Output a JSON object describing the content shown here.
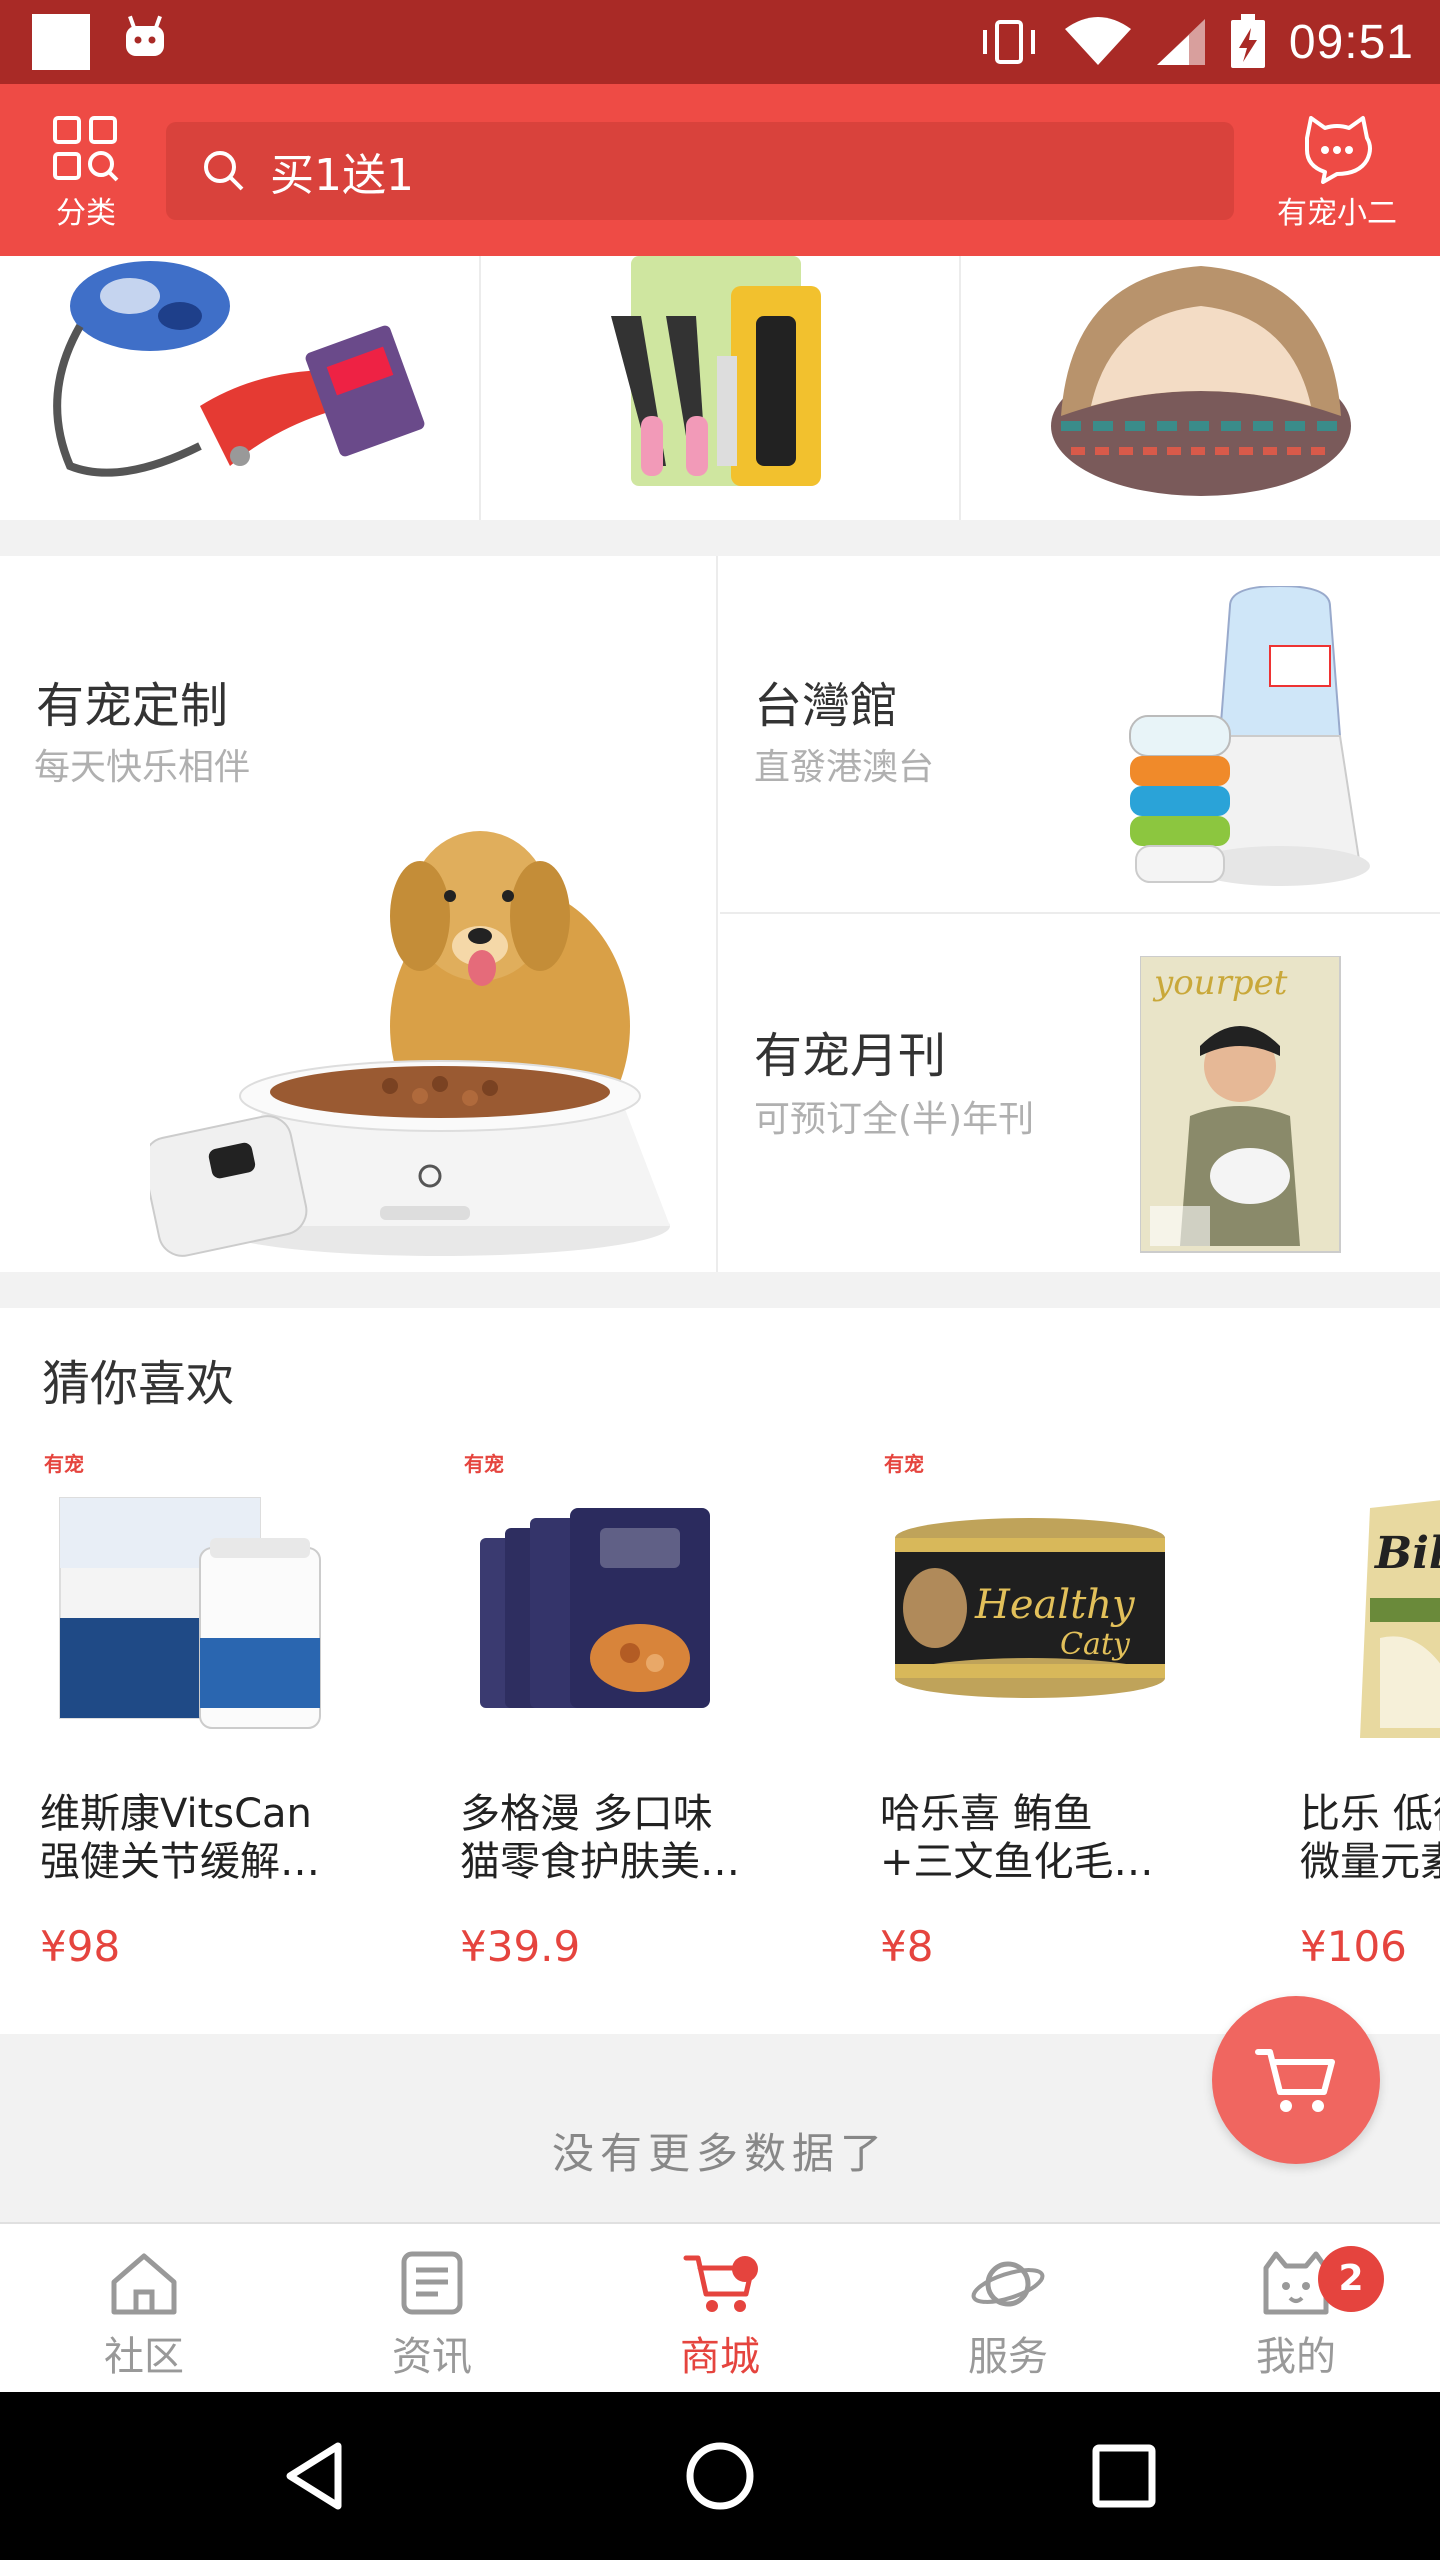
{
  "status_bar": {
    "time": "09:51"
  },
  "header": {
    "category_label": "分类",
    "search_text": "买1送1",
    "service_label": "有宠小二"
  },
  "features": {
    "custom": {
      "title": "有宠定制",
      "subtitle": "每天快乐相伴"
    },
    "taiwan": {
      "title": "台灣館",
      "subtitle": "直發港澳台"
    },
    "monthly": {
      "title": "有宠月刊",
      "subtitle": "可预订全(半)年刊"
    }
  },
  "recommend": {
    "title": "猜你喜欢",
    "items": [
      {
        "brand": "有宠",
        "name": "维斯康VitsCan\n强健关节缓解…",
        "price": "¥98"
      },
      {
        "brand": "有宠",
        "name": "多格漫 多口味\n猫零食护肤美…",
        "price": "¥39.9"
      },
      {
        "brand": "有宠",
        "name": "哈乐喜 鲔鱼\n+三文鱼化毛…",
        "price": "¥8"
      },
      {
        "brand": "",
        "name": "比乐 低徘\n微量元素",
        "price": "¥106"
      }
    ]
  },
  "no_more": "没有更多数据了",
  "bottom_nav": {
    "items": [
      {
        "label": "社区"
      },
      {
        "label": "资讯"
      },
      {
        "label": "商城"
      },
      {
        "label": "服务"
      },
      {
        "label": "我的"
      }
    ],
    "badge_count": "2"
  },
  "colors": {
    "primary": "#ee4b45",
    "status_bar": "#a92a26",
    "price": "#e5443e"
  }
}
